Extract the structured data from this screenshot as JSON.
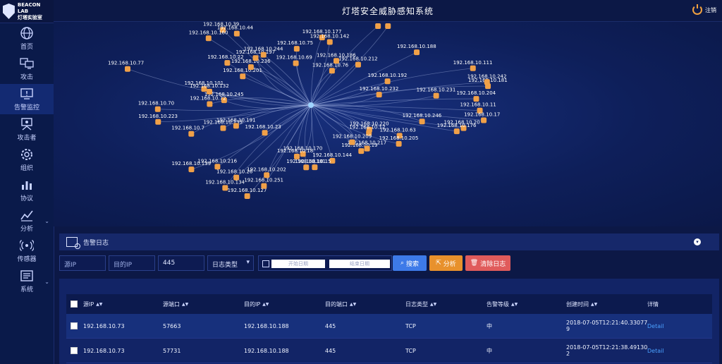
{
  "app": {
    "title": "灯塔安全威胁感知系统",
    "logout": "注销",
    "logo_line1": "BEACON LAB",
    "logo_line2": "灯塔实验室"
  },
  "sidebar": {
    "items": [
      {
        "label": "首页",
        "icon": "globe-icon"
      },
      {
        "label": "攻击",
        "icon": "monitors-icon"
      },
      {
        "label": "告警监控",
        "icon": "alert-monitor-icon"
      },
      {
        "label": "攻击者",
        "icon": "attacker-icon"
      },
      {
        "label": "组织",
        "icon": "gear-icon"
      },
      {
        "label": "协议",
        "icon": "bar-chart-icon"
      },
      {
        "label": "分析",
        "icon": "analysis-icon"
      },
      {
        "label": "传感器",
        "icon": "sensor-icon"
      },
      {
        "label": "系统",
        "icon": "system-icon"
      }
    ]
  },
  "graph": {
    "center": "192.168.10.188",
    "nodes": [
      "192.168.10.11",
      "192.168.10.220",
      "192.168.10.20",
      "192.168.10.17",
      "192.168.10.19",
      "192.168.10.176",
      "192.168.10.63",
      "192.168.10.205",
      "192.168.10.12",
      "192.168.10.217",
      "192.168.10.209",
      "192.168.10.144",
      "192.168.10.15",
      "192.168.10.181",
      "192.168.10.170",
      "192.168.10.127",
      "192.168.10.18",
      "192.168.10.251",
      "192.168.10.202",
      "192.168.10.26",
      "192.168.10.134",
      "192.168.10.139",
      "192.168.10.7",
      "192.168.10.216",
      "192.168.10.133",
      "192.168.10.191",
      "192.168.10.23",
      "192.168.10.223",
      "192.168.10.70",
      "192.168.10.245",
      "192.168.10.72",
      "192.168.10.101",
      "192.168.10.132",
      "192.168.10.77",
      "192.168.10.22",
      "192.168.10.39",
      "192.168.10.44",
      "192.168.10.160",
      "192.168.10.201",
      "192.168.10.236",
      "192.168.10.197",
      "192.168.10.75",
      "192.168.10.244",
      "192.168.10.69",
      "192.168.10.76",
      "192.168.10.177",
      "192.168.10.142",
      "192.168.10.186",
      "192.168.10.178",
      "192.168.10.212",
      "192.168.10.135",
      "192.168.10.111",
      "192.168.10.188",
      "192.168.10.192",
      "192.168.10.181",
      "192.168.10.242",
      "192.168.10.231",
      "192.168.10.204",
      "192.168.10.232",
      "192.168.10.246"
    ]
  },
  "alarm": {
    "title": "告警日志",
    "filters": {
      "src_ip_placeholder": "源IP",
      "dst_ip_placeholder": "目的IP",
      "port_value": "445",
      "log_type": "日志类型",
      "start_date": "开始日期",
      "end_date": "结束日期",
      "search": "搜索",
      "analyze": "分析",
      "clear": "清除日志"
    },
    "columns": [
      "源IP",
      "源端口",
      "目的IP",
      "目的端口",
      "日志类型",
      "告警等级",
      "创建时间",
      "详情"
    ],
    "rows": [
      {
        "src_ip": "192.168.10.73",
        "src_port": "57663",
        "dst_ip": "192.168.10.188",
        "dst_port": "445",
        "type": "TCP",
        "level": "中",
        "time1": "2018-07-05T12:21:40.33077",
        "time2": "9",
        "detail": "Detail"
      },
      {
        "src_ip": "192.168.10.73",
        "src_port": "57731",
        "dst_ip": "192.168.10.188",
        "dst_port": "445",
        "type": "TCP",
        "level": "中",
        "time1": "2018-07-05T12:21:38.49130",
        "time2": "2",
        "detail": "Detail"
      }
    ]
  },
  "colors": {
    "node": "#f0a048",
    "search": "#3d7ae8",
    "analyze": "#e8912c",
    "clear": "#e05b5b",
    "detail": "#4aa0ff"
  }
}
